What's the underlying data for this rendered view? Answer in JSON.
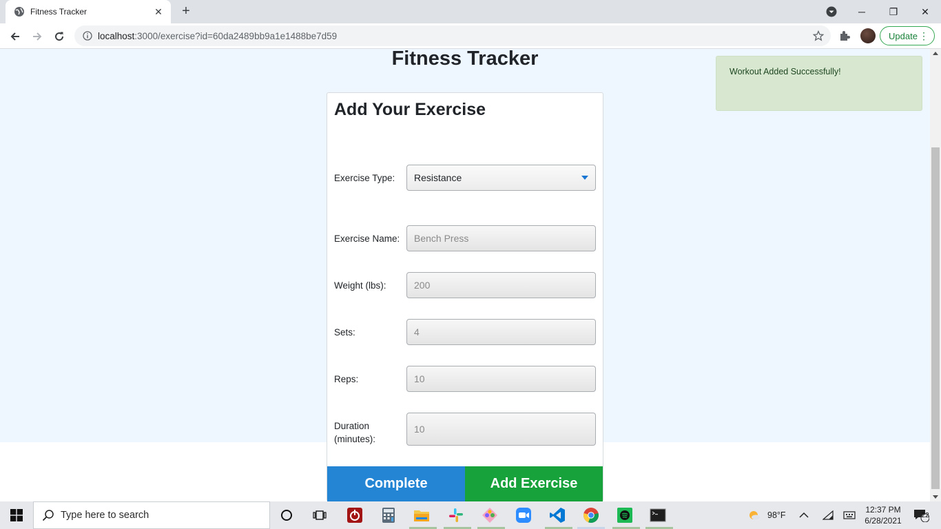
{
  "browser": {
    "tab_title": "Fitness Tracker",
    "url_host": "localhost",
    "url_rest": ":3000/exercise?id=60da2489bb9a1e1488be7d59",
    "update_label": "Update"
  },
  "page": {
    "title": "Fitness Tracker",
    "toast": "Workout Added Successfully!"
  },
  "form": {
    "heading": "Add Your Exercise",
    "type_label": "Exercise Type:",
    "type_value": "Resistance",
    "name_label": "Exercise Name:",
    "name_placeholder": "Bench Press",
    "weight_label": "Weight (lbs):",
    "weight_placeholder": "200",
    "sets_label": "Sets:",
    "sets_placeholder": "4",
    "reps_label": "Reps:",
    "reps_placeholder": "10",
    "duration_label_1": "Duration",
    "duration_label_2": "(minutes):",
    "duration_placeholder": "10",
    "complete_label": "Complete",
    "add_label": "Add Exercise"
  },
  "colors": {
    "page_bg": "#eef6ff",
    "toast_bg": "#d8e8d0",
    "complete_btn": "#2385d4",
    "add_btn": "#17a23c"
  },
  "taskbar": {
    "search_placeholder": "Type here to search",
    "temperature": "98°F",
    "time": "12:37 PM",
    "date": "6/28/2021",
    "notification_count": "22",
    "icons": [
      "cortana-icon",
      "task-view-icon",
      "power-app-icon",
      "calculator-icon",
      "file-explorer-icon",
      "slack-icon",
      "app-icon",
      "zoom-icon",
      "vscode-icon",
      "chrome-icon",
      "spotify-icon",
      "terminal-icon"
    ]
  }
}
